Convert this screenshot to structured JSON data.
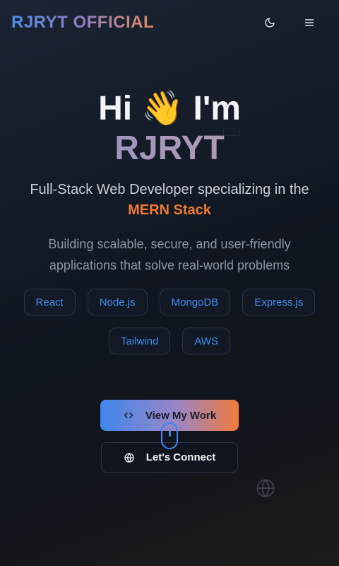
{
  "header": {
    "brand_part1": "RJRYT",
    "brand_part2": "OFFICIAL"
  },
  "hero": {
    "greeting": "Hi 👋 I'm",
    "name": "RJRYT",
    "subtitle": "Full-Stack Web Developer specializing in the",
    "stack": "MERN Stack",
    "description": "Building scalable, secure, and user-friendly applications that solve real-world problems"
  },
  "skills": [
    "React",
    "Node.js",
    "MongoDB",
    "Express.js",
    "Tailwind",
    "AWS"
  ],
  "actions": {
    "primary_label": "View My Work",
    "secondary_label": "Let's Connect"
  },
  "icons": {
    "theme": "moon-icon",
    "menu": "hamburger-icon",
    "code": "code-icon",
    "globe": "globe-icon",
    "scroll": "mouse-scroll-icon"
  },
  "colors": {
    "accent_blue": "#3f8ef0",
    "accent_orange": "#f07a2e",
    "background": "#111722"
  }
}
